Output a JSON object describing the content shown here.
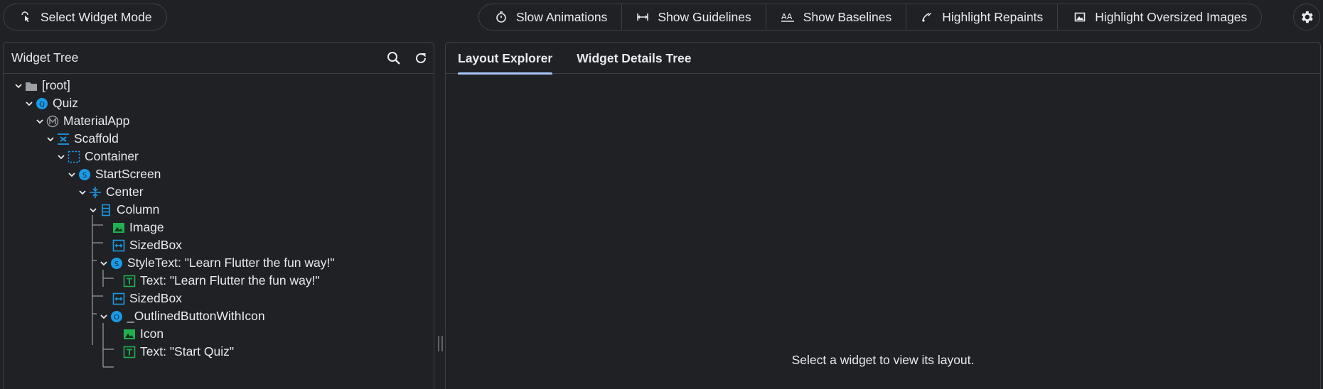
{
  "toolbar": {
    "select_widget_mode": "Select Widget Mode",
    "slow_animations": "Slow Animations",
    "show_guidelines": "Show Guidelines",
    "show_baselines": "Show Baselines",
    "highlight_repaints": "Highlight Repaints",
    "highlight_oversized_images": "Highlight Oversized Images"
  },
  "widget_tree": {
    "title": "Widget Tree",
    "nodes": [
      {
        "label": "[root]",
        "icon": "folder-icon"
      },
      {
        "label": "Quiz",
        "icon": "circle-q-icon"
      },
      {
        "label": "MaterialApp",
        "icon": "material-m-icon"
      },
      {
        "label": "Scaffold",
        "icon": "scaffold-icon"
      },
      {
        "label": "Container",
        "icon": "container-icon"
      },
      {
        "label": "StartScreen",
        "icon": "circle-s-icon"
      },
      {
        "label": "Center",
        "icon": "center-icon"
      },
      {
        "label": "Column",
        "icon": "column-icon"
      },
      {
        "label": "Image",
        "icon": "image-icon"
      },
      {
        "label": "SizedBox",
        "icon": "sizedbox-icon"
      },
      {
        "label": "StyleText: \"Learn Flutter the fun way!\"",
        "icon": "circle-s-icon"
      },
      {
        "label": "Text: \"Learn Flutter the fun way!\"",
        "icon": "text-t-icon"
      },
      {
        "label": "SizedBox",
        "icon": "sizedbox-icon"
      },
      {
        "label": "_OutlinedButtonWithIcon",
        "icon": "circle-o-icon"
      },
      {
        "label": "Icon",
        "icon": "image-icon"
      },
      {
        "label": "Text: \"Start Quiz\"",
        "icon": "text-t-icon"
      }
    ]
  },
  "right_panel": {
    "tabs": [
      "Layout Explorer",
      "Widget Details Tree"
    ],
    "active_tab": "Layout Explorer",
    "empty_message": "Select a widget to view its layout."
  },
  "colors": {
    "background": "#202124",
    "border": "#3c4043",
    "accent_blue": "#1a9be8",
    "accent_green": "#20b050",
    "tab_indicator": "#a8c7fa"
  }
}
